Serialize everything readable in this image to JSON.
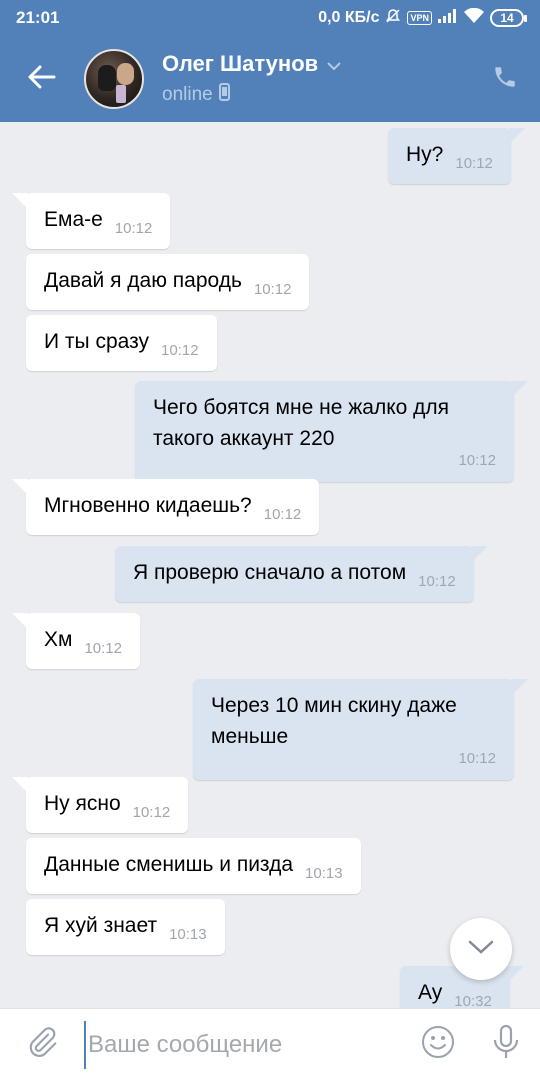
{
  "status_bar": {
    "time": "21:01",
    "network_speed": "0,0 КБ/с",
    "vpn": "VPN",
    "battery": "14"
  },
  "header": {
    "contact_name": "Олег Шатунов",
    "status": "online",
    "icons": [
      "arrow-back-icon",
      "chevron-down-icon",
      "mobile-icon",
      "phone-icon"
    ],
    "accent_color": "#5181b8"
  },
  "messages": [
    {
      "dir": "out",
      "text": "Ну?",
      "time": "10:12"
    },
    {
      "dir": "in",
      "text": "Ема-е",
      "time": "10:12"
    },
    {
      "dir": "in",
      "text": "Давай я даю пародь",
      "time": "10:12"
    },
    {
      "dir": "in",
      "text": "И ты сразу",
      "time": "10:12"
    },
    {
      "dir": "out",
      "text": "Чего боятся мне не жалко для такого аккаунт 220",
      "time": "10:12"
    },
    {
      "dir": "in",
      "text": "Мгновенно кидаешь?",
      "time": "10:12"
    },
    {
      "dir": "out",
      "text": "Я проверю сначало а потом",
      "time": "10:12"
    },
    {
      "dir": "in",
      "text": "Хм",
      "time": "10:12"
    },
    {
      "dir": "out",
      "text": "Через 10 мин скину даже меньше",
      "time": "10:12"
    },
    {
      "dir": "in",
      "text": "Ну ясно",
      "time": "10:12"
    },
    {
      "dir": "in",
      "text": "Данные сменишь и пизда",
      "time": "10:13"
    },
    {
      "dir": "in",
      "text": "Я хуй знает",
      "time": "10:13"
    },
    {
      "dir": "out",
      "text": "Ау",
      "time": "10:32"
    }
  ],
  "input": {
    "placeholder": "Ваше сообщение",
    "value": ""
  },
  "colors": {
    "incoming_bubble": "#ffffff",
    "outgoing_bubble": "#dae4f0",
    "chat_background": "#ebedf0"
  }
}
